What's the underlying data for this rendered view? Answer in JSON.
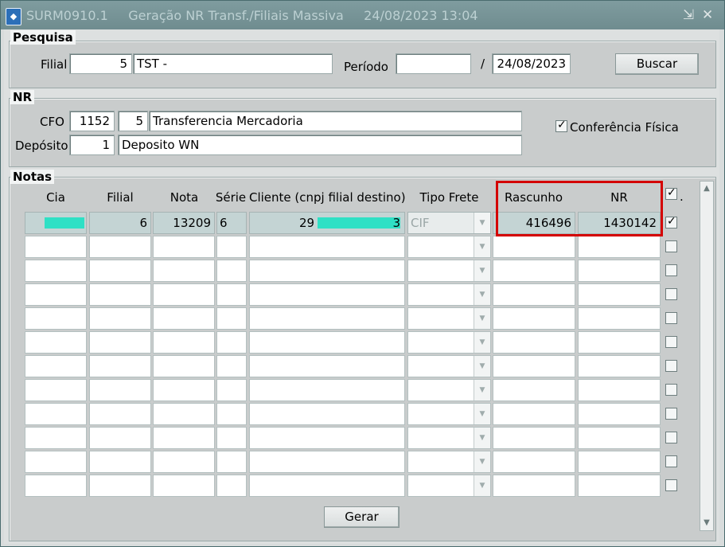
{
  "window": {
    "title": "SURM0910.1     Geração NR Transf./Filiais Massiva     24/08/2023 13:04"
  },
  "pesquisa": {
    "title": "Pesquisa",
    "filial_label": "Filial",
    "filial_code": "5",
    "filial_name": "TST -",
    "periodo_label": "Período",
    "periodo_from": "",
    "periodo_sep": "/",
    "periodo_to": "24/08/2023",
    "buscar_label": "Buscar"
  },
  "nr": {
    "title": "NR",
    "cfo_label": "CFO",
    "cfo_code": "1152",
    "cfo_num": "5",
    "cfo_desc": "Transferencia Mercadoria",
    "deposito_label": "Depósito",
    "deposito_code": "1",
    "deposito_desc": "Deposito WN",
    "conferencia_label": "Conferência Física",
    "conferencia_checked": true
  },
  "notas": {
    "title": "Notas",
    "columns": [
      "Cia",
      "Filial",
      "Nota",
      "Série",
      "Cliente (cnpj filial destino)",
      "Tipo Frete",
      "Rascunho",
      "NR"
    ],
    "rows": [
      {
        "cia": "",
        "filial": "6",
        "nota": "13209",
        "serie": "6",
        "cliente": "29",
        "cliente_suffix": "3",
        "tipo_frete": "CIF",
        "rascunho": "416496",
        "nr": "1430142",
        "checked": true
      }
    ],
    "gerar_label": "Gerar",
    "select_all_suffix": "."
  },
  "colors": {
    "highlight": "#d40000",
    "redaction": "#2fe0c5",
    "titlebar": "#7a979a"
  }
}
